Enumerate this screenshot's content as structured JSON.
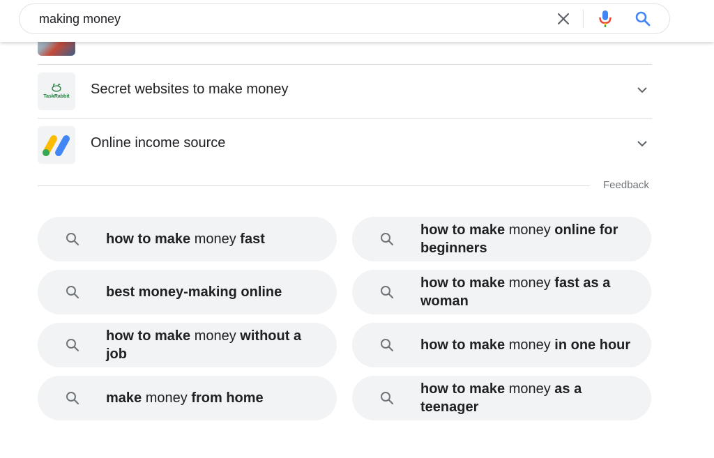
{
  "search": {
    "query": "making money",
    "clear_icon": "close-icon",
    "mic_icon": "microphone-icon",
    "search_icon": "search-icon"
  },
  "results": [
    {
      "label": "Secret websites to make money",
      "thumb_text": "TaskRabbit"
    },
    {
      "label": "Online income source",
      "thumb_text": ""
    }
  ],
  "feedback_label": "Feedback",
  "related_searches": [
    {
      "segments": [
        {
          "t": "how to make",
          "b": true
        },
        {
          "t": " money ",
          "b": false
        },
        {
          "t": "fast",
          "b": true
        }
      ]
    },
    {
      "segments": [
        {
          "t": "how to make",
          "b": true
        },
        {
          "t": " money ",
          "b": false
        },
        {
          "t": "online for beginners",
          "b": true
        }
      ]
    },
    {
      "segments": [
        {
          "t": "best money-making online",
          "b": true
        }
      ]
    },
    {
      "segments": [
        {
          "t": "how to make",
          "b": true
        },
        {
          "t": " money ",
          "b": false
        },
        {
          "t": "fast as a woman",
          "b": true
        }
      ]
    },
    {
      "segments": [
        {
          "t": "how to make",
          "b": true
        },
        {
          "t": " money ",
          "b": false
        },
        {
          "t": "without a job",
          "b": true
        }
      ]
    },
    {
      "segments": [
        {
          "t": "how to make",
          "b": true
        },
        {
          "t": " money ",
          "b": false
        },
        {
          "t": "in one hour",
          "b": true
        }
      ]
    },
    {
      "segments": [
        {
          "t": "make",
          "b": true
        },
        {
          "t": " money ",
          "b": false
        },
        {
          "t": "from home",
          "b": true
        }
      ]
    },
    {
      "segments": [
        {
          "t": "how to make",
          "b": true
        },
        {
          "t": " money ",
          "b": false
        },
        {
          "t": "as a teenager",
          "b": true
        }
      ]
    }
  ],
  "colors": {
    "google_blue": "#4285f4",
    "google_red": "#ea4335",
    "google_yellow": "#fbbc04",
    "google_green": "#34a853",
    "taskrabbit_green": "#1f7a3a",
    "chip_bg": "#f1f3f4"
  }
}
